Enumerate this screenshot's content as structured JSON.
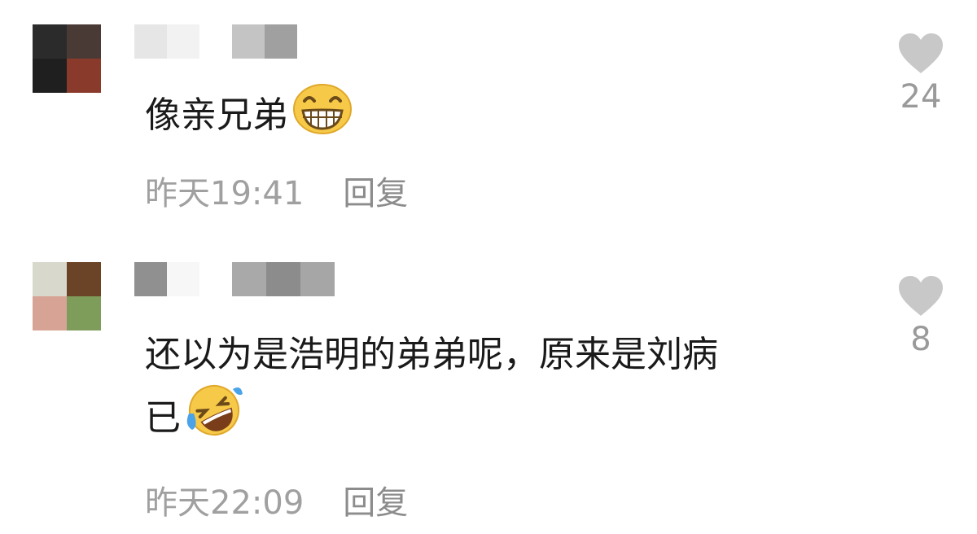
{
  "comments": [
    {
      "content": "像亲兄弟",
      "emoji": "grinning-face-icon",
      "time": "昨天19:41",
      "reply_label": "回复",
      "likes": "24",
      "avatar_colors": [
        "#2b2b2b",
        "#4a3a36",
        "#1f1f1f",
        "#8a3a2a"
      ]
    },
    {
      "content_line1": "还以为是浩明的弟弟呢，原来是刘病",
      "content_line2": "已",
      "emoji": "rolling-on-floor-laughing-icon",
      "time": "昨天22:09",
      "reply_label": "回复",
      "likes": "8",
      "avatar_colors": [
        "#d8d8cc",
        "#6b4326",
        "#d6a395",
        "#7e9c5a"
      ]
    }
  ],
  "colors": {
    "text": "#1a1a1a",
    "meta": "#a0a0a0",
    "heart": "#c8c8c8",
    "emoji_face": "#f7c948"
  }
}
